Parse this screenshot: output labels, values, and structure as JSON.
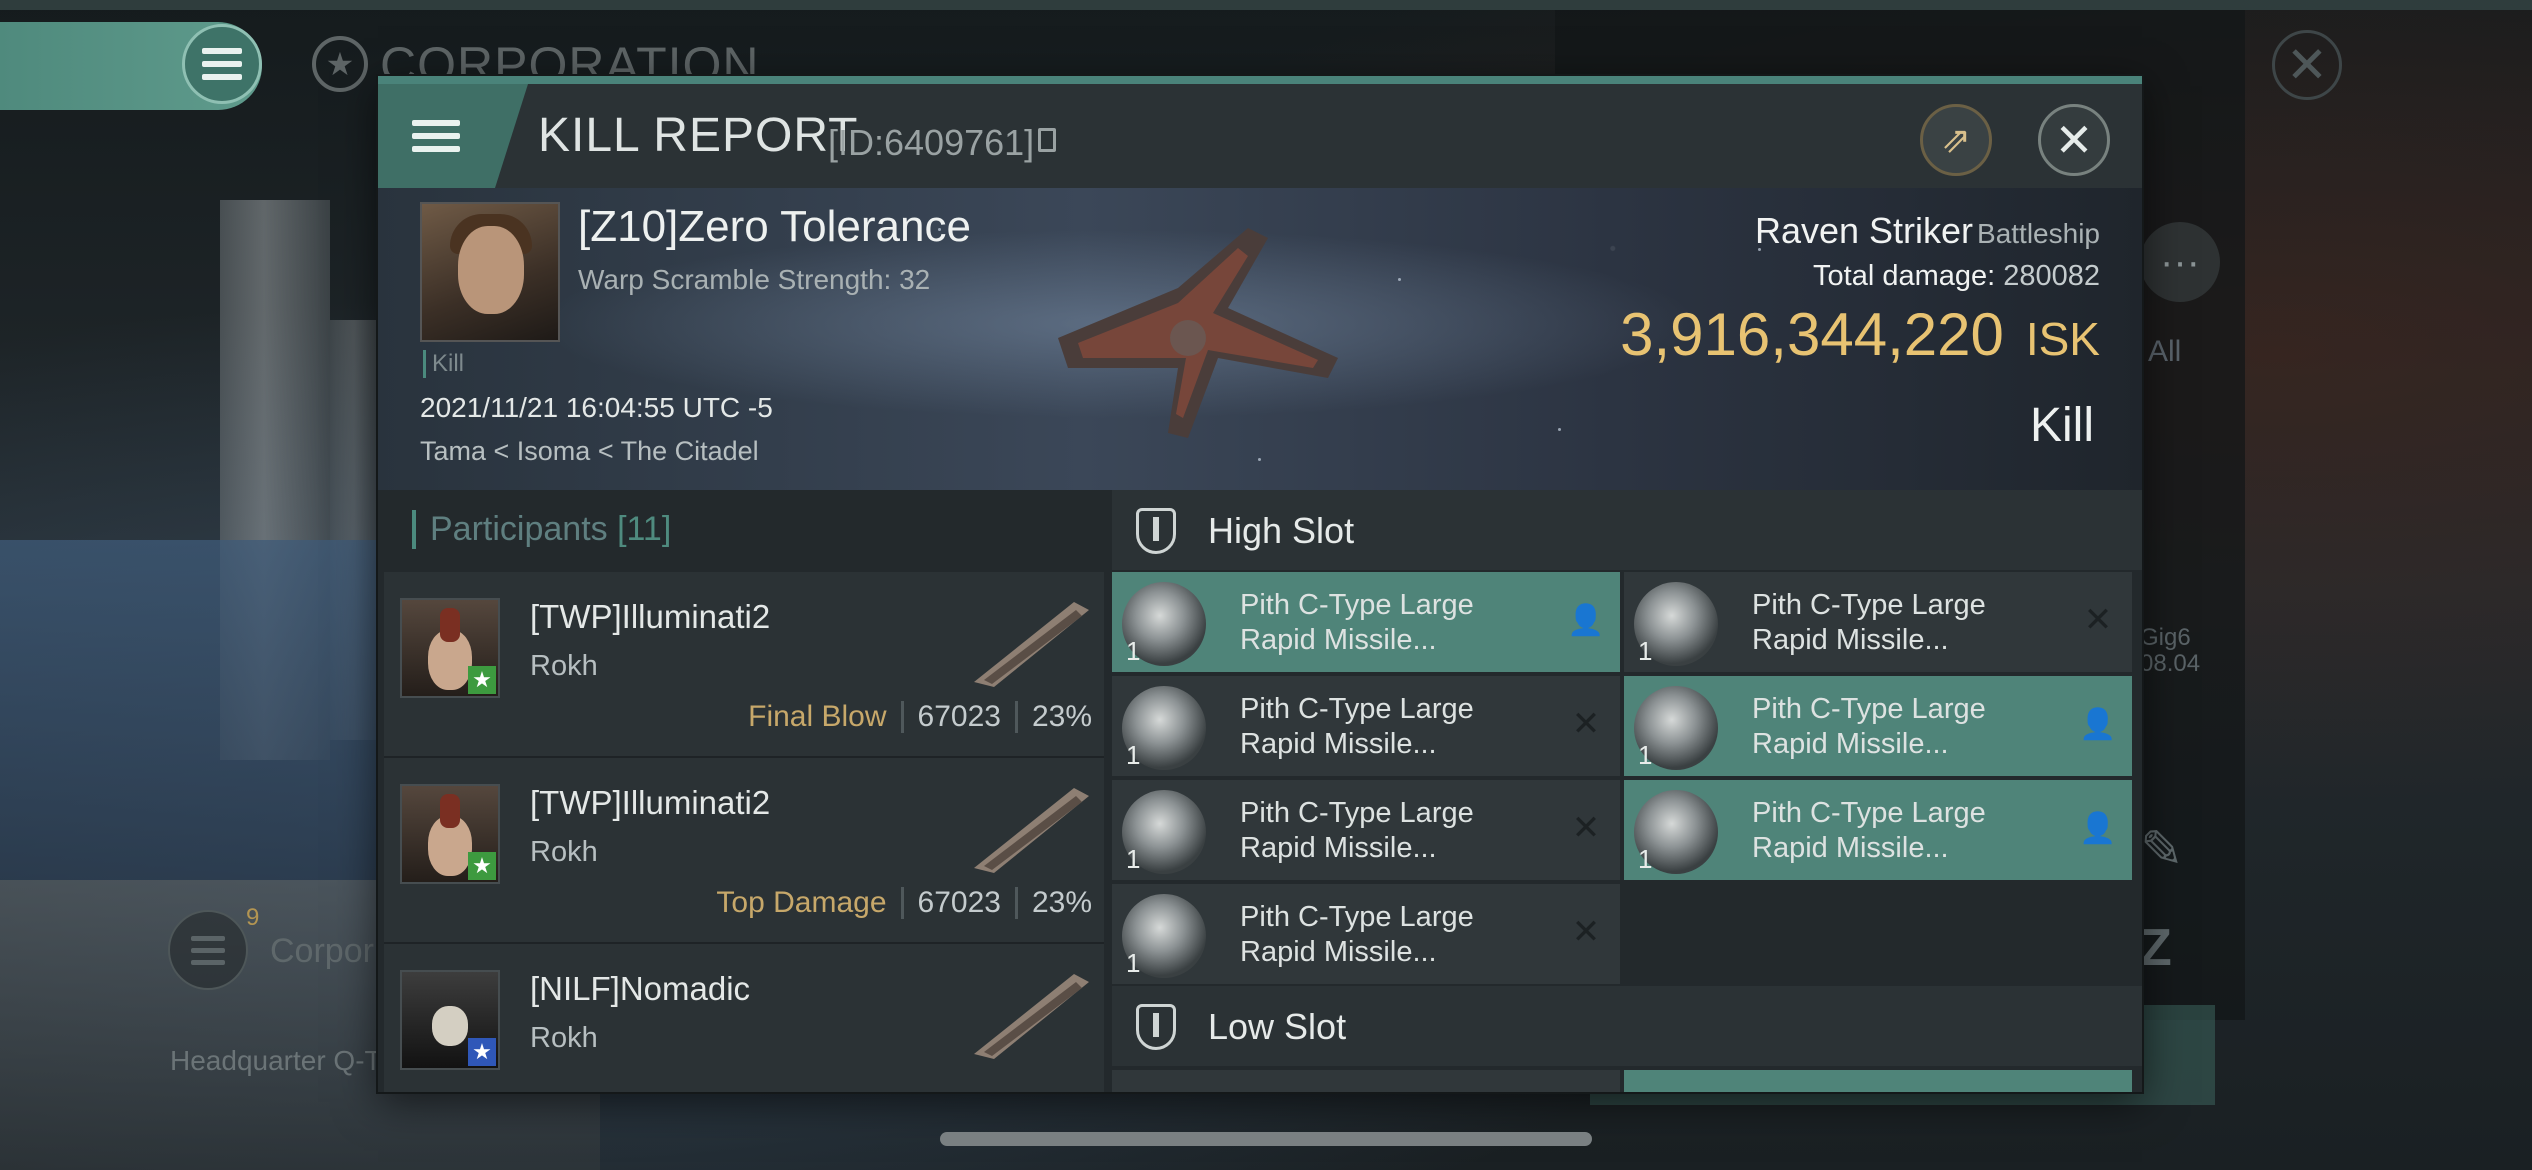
{
  "background": {
    "corporation_title": "CORPORATION",
    "corp_badge_count": "9",
    "corp_label": "Corpor",
    "headquarter_text": "Headquarter Q-T",
    "all_label": "All",
    "gig_text": "Gig6",
    "gig_date": "08.04"
  },
  "header": {
    "title": "KILL REPORT",
    "report_id": "[ID:6409761]"
  },
  "victim": {
    "name": "[Z10]Zero Tolerance",
    "warp_scramble": "Warp Scramble Strength: 32",
    "kill_tag": "Kill",
    "datetime": "2021/11/21 16:04:55 UTC -5",
    "location": "Tama < Isoma < The Citadel",
    "ship_name": "Raven Striker",
    "ship_class": "Battleship",
    "total_damage_label": "Total damage:",
    "total_damage": "280082",
    "isk_value": "3,916,344,220",
    "isk_unit": "ISK",
    "kill_type": "Kill"
  },
  "participants": {
    "label": "Participants",
    "count": "[11]",
    "rows": [
      {
        "name": "[TWP]Illuminati2",
        "ship": "Rokh",
        "tag": "Final Blow",
        "damage": "67023",
        "percent": "23%",
        "badge": "green"
      },
      {
        "name": "[TWP]Illuminati2",
        "ship": "Rokh",
        "tag": "Top Damage",
        "damage": "67023",
        "percent": "23%",
        "badge": "green"
      },
      {
        "name": "[NILF]Nomadic",
        "ship": "Rokh",
        "tag": "",
        "damage": "",
        "percent": "",
        "badge": "blue"
      }
    ]
  },
  "fitting": {
    "high_slot_label": "High Slot",
    "low_slot_label": "Low Slot",
    "high_slot_modules": [
      {
        "name_line1": "Pith C-Type Large",
        "name_line2": "Rapid Missile...",
        "qty": "1",
        "status": "dropped"
      },
      {
        "name_line1": "Pith C-Type Large",
        "name_line2": "Rapid Missile...",
        "qty": "1",
        "status": "destroyed"
      },
      {
        "name_line1": "Pith C-Type Large",
        "name_line2": "Rapid Missile...",
        "qty": "1",
        "status": "destroyed"
      },
      {
        "name_line1": "Pith C-Type Large",
        "name_line2": "Rapid Missile...",
        "qty": "1",
        "status": "dropped"
      },
      {
        "name_line1": "Pith C-Type Large",
        "name_line2": "Rapid Missile...",
        "qty": "1",
        "status": "destroyed"
      },
      {
        "name_line1": "Pith C-Type Large",
        "name_line2": "Rapid Missile...",
        "qty": "1",
        "status": "dropped"
      },
      {
        "name_line1": "Pith C-Type Large",
        "name_line2": "Rapid Missile...",
        "qty": "1",
        "status": "destroyed"
      }
    ]
  },
  "colors": {
    "accent_teal": "#4f8479",
    "isk_gold": "#e8c372",
    "label_gold": "#c7a86a"
  }
}
